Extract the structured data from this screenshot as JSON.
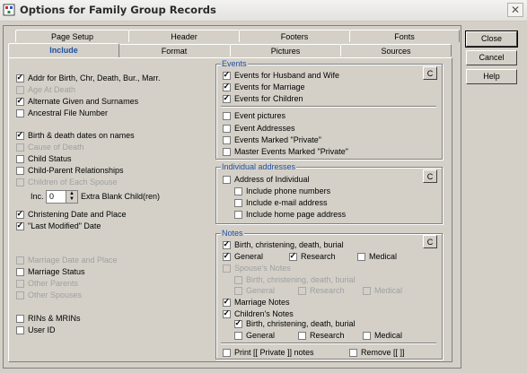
{
  "window": {
    "title": "Options for Family Group Records",
    "close_glyph": "✕"
  },
  "tabs": {
    "row1": [
      "Page Setup",
      "Header",
      "Footers",
      "Fonts"
    ],
    "row2": [
      "Include",
      "Format",
      "Pictures",
      "Sources"
    ],
    "active": "Include"
  },
  "left": {
    "items": [
      {
        "label": "Addr for Birth, Chr, Death, Bur., Marr.",
        "checked": true,
        "enabled": true
      },
      {
        "label": "Age At Death",
        "checked": false,
        "enabled": false
      },
      {
        "label": "Alternate Given and Surnames",
        "checked": true,
        "enabled": true
      },
      {
        "label": "Ancestral File Number",
        "checked": false,
        "enabled": true
      },
      {
        "label": "Birth & death dates on names",
        "checked": true,
        "enabled": true
      },
      {
        "label": "Cause of Death",
        "checked": false,
        "enabled": false
      },
      {
        "label": "Child Status",
        "checked": false,
        "enabled": true
      },
      {
        "label": "Child-Parent Relationships",
        "checked": false,
        "enabled": true
      },
      {
        "label": "Children of Each Spouse",
        "checked": false,
        "enabled": false
      },
      {
        "label": "Christening Date and Place",
        "checked": true,
        "enabled": true
      },
      {
        "label": "\"Last Modified\" Date",
        "checked": true,
        "enabled": true
      },
      {
        "label": "Marriage Date and Place",
        "checked": false,
        "enabled": false
      },
      {
        "label": "Marriage Status",
        "checked": false,
        "enabled": true
      },
      {
        "label": "Other Parents",
        "checked": false,
        "enabled": false
      },
      {
        "label": "Other Spouses",
        "checked": false,
        "enabled": false
      },
      {
        "label": "RINs & MRINs",
        "checked": false,
        "enabled": true
      },
      {
        "label": "User ID",
        "checked": false,
        "enabled": true
      }
    ],
    "inc_label": "Inc.",
    "inc_value": "0",
    "extra_label": "Extra Blank Child(ren)"
  },
  "events": {
    "title": "Events",
    "c_button": "C",
    "items": [
      {
        "label": "Events for Husband and Wife",
        "checked": true,
        "enabled": true
      },
      {
        "label": "Events for Marriage",
        "checked": true,
        "enabled": true
      },
      {
        "label": "Events for Children",
        "checked": true,
        "enabled": true
      },
      {
        "label": "Event pictures",
        "checked": false,
        "enabled": true
      },
      {
        "label": "Event Addresses",
        "checked": false,
        "enabled": true
      },
      {
        "label": "Events Marked \"Private\"",
        "checked": false,
        "enabled": true
      },
      {
        "label": "Master Events Marked \"Private\"",
        "checked": false,
        "enabled": true
      }
    ]
  },
  "addresses": {
    "title": "Individual addresses",
    "c_button": "C",
    "items": [
      {
        "label": "Address of Individual",
        "checked": false,
        "enabled": true
      },
      {
        "label": "Include phone numbers",
        "checked": false,
        "enabled": true
      },
      {
        "label": "Include e-mail address",
        "checked": false,
        "enabled": true
      },
      {
        "label": "Include home page address",
        "checked": false,
        "enabled": true
      }
    ]
  },
  "notes": {
    "title": "Notes",
    "c_button": "C",
    "items": [
      {
        "label": "Birth, christening, death, burial",
        "checked": true,
        "enabled": true
      },
      {
        "label": "General",
        "checked": true,
        "enabled": true
      },
      {
        "label": "Research",
        "checked": true,
        "enabled": true
      },
      {
        "label": "Medical",
        "checked": false,
        "enabled": true
      },
      {
        "label": "Spouse's Notes",
        "checked": false,
        "enabled": false
      },
      {
        "label": "Birth, christening, death, burial",
        "checked": false,
        "enabled": false
      },
      {
        "label": "General",
        "checked": false,
        "enabled": false
      },
      {
        "label": "Research",
        "checked": false,
        "enabled": false
      },
      {
        "label": "Medical",
        "checked": false,
        "enabled": false
      },
      {
        "label": "Marriage Notes",
        "checked": true,
        "enabled": true
      },
      {
        "label": "Children's Notes",
        "checked": true,
        "enabled": true
      },
      {
        "label": "Birth, christening, death, burial",
        "checked": true,
        "enabled": true
      },
      {
        "label": "General",
        "checked": false,
        "enabled": true
      },
      {
        "label": "Research",
        "checked": false,
        "enabled": true
      },
      {
        "label": "Medical",
        "checked": false,
        "enabled": true
      },
      {
        "label": "Print [[ Private ]] notes",
        "checked": false,
        "enabled": true
      },
      {
        "label": "Remove [[  ]]",
        "checked": false,
        "enabled": true
      }
    ]
  },
  "buttons": {
    "close": "Close",
    "cancel": "Cancel",
    "help": "Help"
  }
}
